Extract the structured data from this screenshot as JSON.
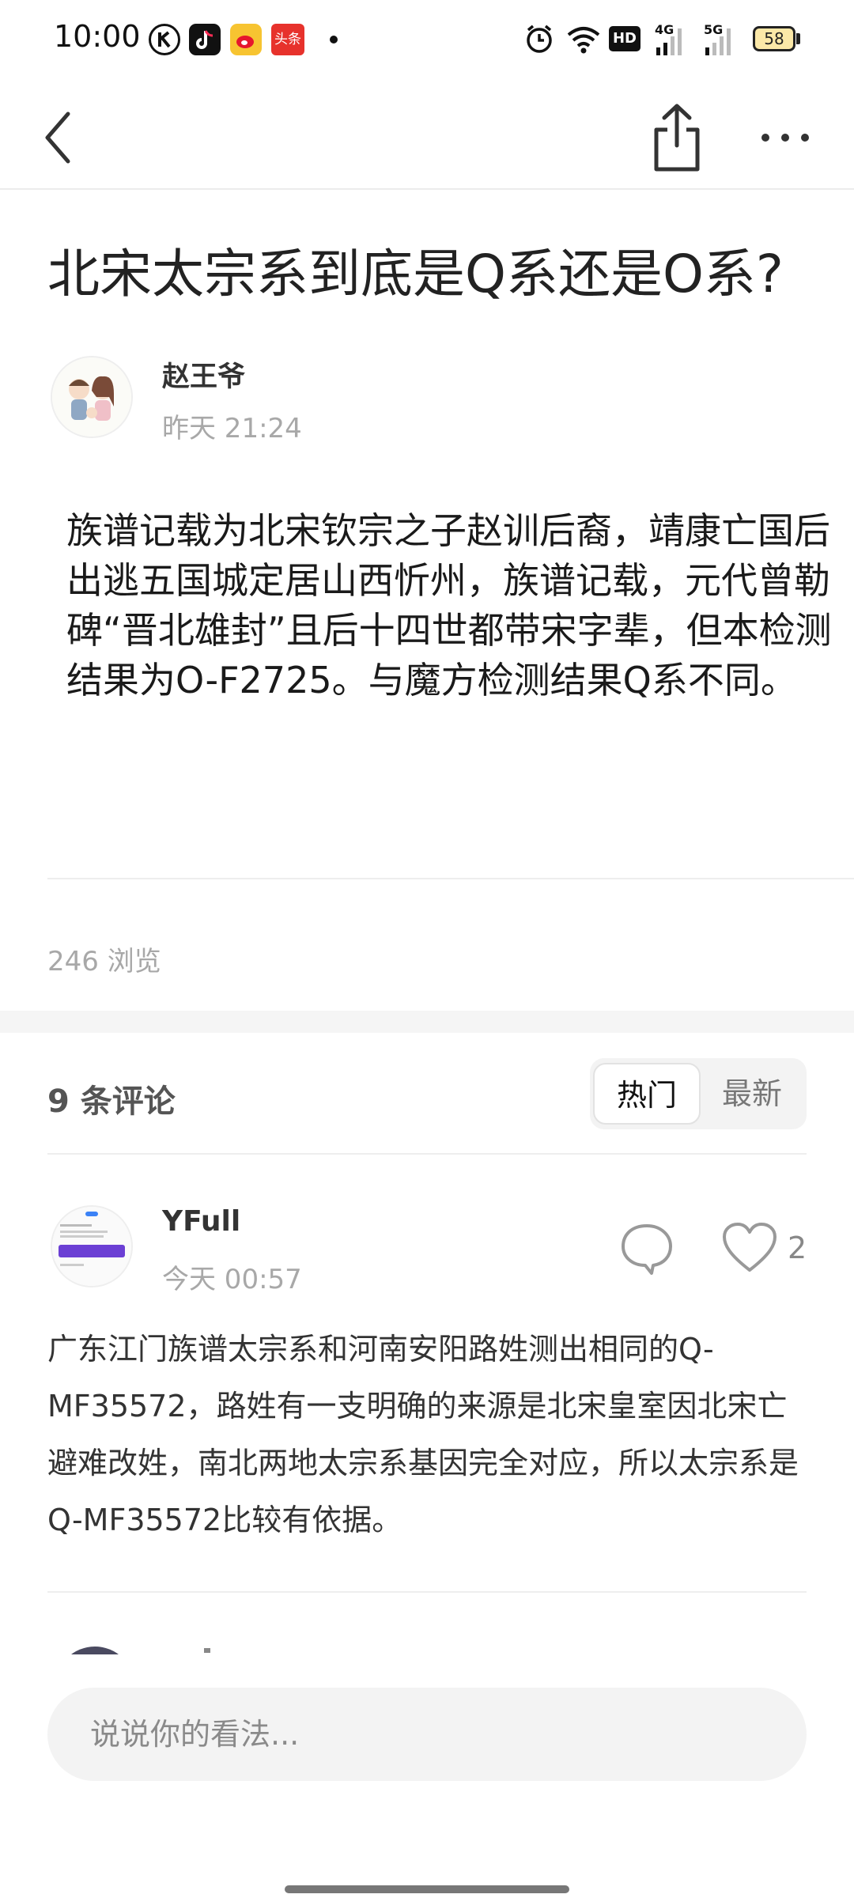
{
  "status_bar": {
    "time": "10:00",
    "app_icons": [
      "k-app-icon",
      "tiktok-icon",
      "weibo-icon",
      "toutiao-icon"
    ],
    "toutiao_text": "头条",
    "hd_label": "HD",
    "network_4g": "4G",
    "network_5g": "5G",
    "battery": "58"
  },
  "nav": {
    "back_icon": "chevron-left-icon",
    "share_icon": "share-icon",
    "more_icon": "more-icon"
  },
  "post": {
    "title": "北宋太宗系到底是Q系还是O系?",
    "author": "赵王爷",
    "time": "昨天 21:24",
    "body": "族谱记载为北宋钦宗之子赵训后裔，靖康亡国后出逃五国城定居山西忻州，族谱记载，元代曾勒碑“晋北雄封”且后十四世都带宋字辈，但本检测结果为O-F2725。与魔方检测结果Q系不同。",
    "views": "246 浏览"
  },
  "comments": {
    "count_label": "9 条评论",
    "sort_tabs": [
      "热门",
      "最新"
    ],
    "active_tab": "热门",
    "items": [
      {
        "author": "YFull",
        "time": "今天 00:57",
        "likes": "2",
        "body": "广东江门族谱太宗系和河南安阳路姓测出相同的Q-MF35572，路姓有一支明确的来源是北宋皇室因北宋亡避难改姓，南北两地太宗系基因完全对应，所以太宗系是Q-MF35572比较有依据。"
      }
    ]
  },
  "input": {
    "placeholder": "说说你的看法..."
  }
}
